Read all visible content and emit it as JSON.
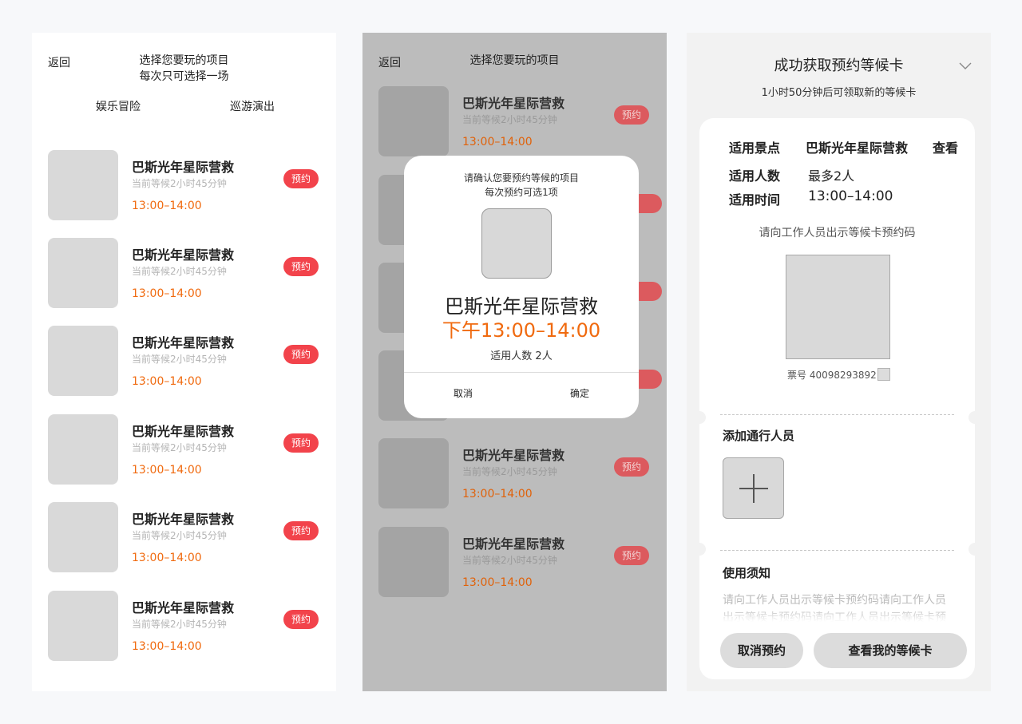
{
  "list_screen": {
    "back_label": "返回",
    "title": "选择您要玩的项目",
    "subtitle": "每次只可选择一场",
    "tabs": [
      "娱乐冒险",
      "巡游演出"
    ],
    "items": [
      {
        "name": "巴斯光年星际营救",
        "wait": "当前等候2小时45分钟",
        "time": "13:00–14:00",
        "action": "预约"
      },
      {
        "name": "巴斯光年星际营救",
        "wait": "当前等候2小时45分钟",
        "time": "13:00–14:00",
        "action": "预约"
      },
      {
        "name": "巴斯光年星际营救",
        "wait": "当前等候2小时45分钟",
        "time": "13:00–14:00",
        "action": "预约"
      },
      {
        "name": "巴斯光年星际营救",
        "wait": "当前等候2小时45分钟",
        "time": "13:00–14:00",
        "action": "预约"
      },
      {
        "name": "巴斯光年星际营救",
        "wait": "当前等候2小时45分钟",
        "time": "13:00–14:00",
        "action": "预约"
      },
      {
        "name": "巴斯光年星际营救",
        "wait": "当前等候2小时45分钟",
        "time": "13:00–14:00",
        "action": "预约"
      }
    ]
  },
  "confirm_screen": {
    "back_label": "返回",
    "title": "选择您要玩的项目",
    "items": [
      {
        "name": "巴斯光年星际营救",
        "wait": "当前等候2小时45分钟",
        "time": "13:00–14:00",
        "action": "预约"
      },
      {
        "name": "巴斯光年星际营救",
        "wait": "当前等候2小时45分钟",
        "time": "13:00–14:00",
        "action": "预约"
      },
      {
        "name": "巴斯光年星际营救",
        "wait": "当前等候2小时45分钟",
        "time": "13:00–14:00",
        "action": "预约"
      }
    ],
    "modal": {
      "line1": "请确认您要预约等候的项目",
      "line2": "每次预约可选1项",
      "name": "巴斯光年星际营救",
      "time": "下午13:00–14:00",
      "people": "适用人数 2人",
      "cancel": "取消",
      "confirm": "确定"
    }
  },
  "success_screen": {
    "title": "成功获取预约等候卡",
    "subtitle": "1小时50分钟后可领取新的等候卡",
    "spot_label": "适用景点",
    "spot_value": "巴斯光年星际营救",
    "view_link": "查看",
    "people_label": "适用人数",
    "people_value": "最多2人",
    "time_label": "适用时间",
    "time_value": "13:00–14:00",
    "code_hint": "请向工作人员出示等候卡预约码",
    "ticket_no": "票号 40098293892",
    "companions_title": "添加通行人员",
    "notice_title": "使用须知",
    "notice_text": "请向工作人员出示等候卡预约码请向工作人员出示等候卡预约码请向工作人员出示等候卡预约码",
    "cancel_button": "取消预约",
    "view_button": "查看我的等候卡"
  },
  "colors": {
    "accent_orange": "#f06a0f",
    "reserve_red": "#f2434b",
    "placeholder_gray": "#d9d9d9"
  }
}
